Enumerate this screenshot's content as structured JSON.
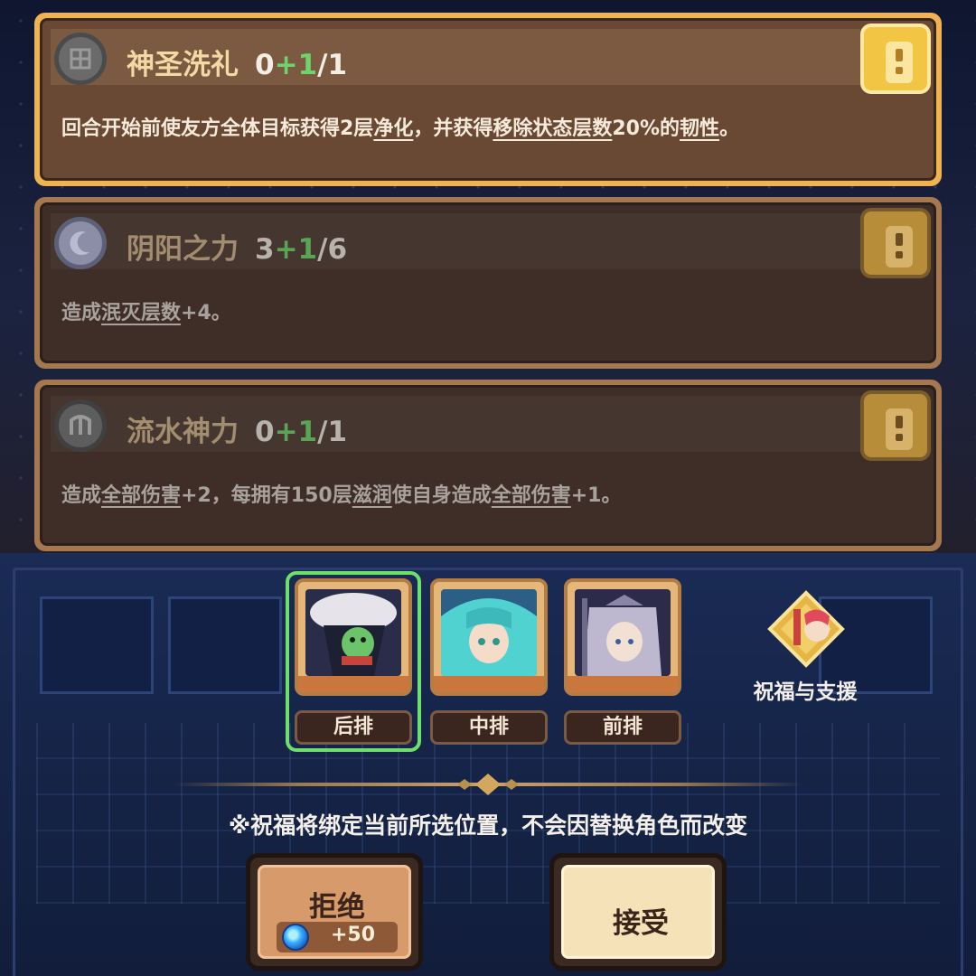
{
  "blessings": [
    {
      "title": "神圣洗礼",
      "count_base": "0",
      "count_plus": "+1",
      "count_max": "/1",
      "desc_parts": [
        "回合开始前使友方全体目标获得2层",
        "净化",
        "，并获得",
        "移除状态",
        "层数",
        "20%的",
        "韧性",
        "。"
      ],
      "icon": "holy-rune-icon",
      "selected": true
    },
    {
      "title": "阴阳之力",
      "count_base": "3",
      "count_plus": "+1",
      "count_max": "/6",
      "desc_parts": [
        "造成",
        "泯灭层数",
        "+4。"
      ],
      "icon": "moon-rune-icon",
      "selected": false
    },
    {
      "title": "流水神力",
      "count_base": "0",
      "count_plus": "+1",
      "count_max": "/1",
      "desc_parts": [
        "造成",
        "全部伤害",
        "+2，每拥有150层",
        "滋润",
        "使自身造成",
        "全部伤害",
        "+1。"
      ],
      "icon": "water-rune-icon",
      "selected": false
    }
  ],
  "positions": [
    {
      "label": "后排",
      "selected": true
    },
    {
      "label": "中排",
      "selected": false
    },
    {
      "label": "前排",
      "selected": false
    }
  ],
  "blessing_support": {
    "label": "祝福与支援"
  },
  "note": "※祝福将绑定当前所选位置，不会因替换角色而改变",
  "buttons": {
    "reject": {
      "label": "拒绝",
      "cost": "+50"
    },
    "accept": {
      "label": "接受"
    }
  },
  "colors": {
    "selected_ring": "#6de06a",
    "card_active_border": "#f0b354",
    "plus_green": "#6fd26a"
  }
}
